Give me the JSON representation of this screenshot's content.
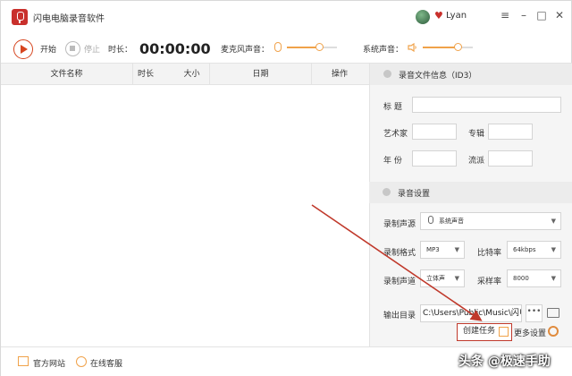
{
  "app": {
    "title": "闪电电脑录音软件",
    "user": "Lyan"
  },
  "window_controls": {
    "menu": "≡",
    "minimize": "–",
    "maximize": "□",
    "close": "✕"
  },
  "toolbar": {
    "start_label": "开始",
    "stop_label": "停止",
    "duration_label": "时长：",
    "duration_value": "00:00:00",
    "mic_volume_label": "麦克风声音：",
    "system_volume_label": "系统声音：",
    "mic_volume_level": 0.65,
    "system_volume_level": 0.7
  },
  "file_table": {
    "columns": [
      "文件名称",
      "时长",
      "大小",
      "日期",
      "操作"
    ],
    "rows": []
  },
  "id3_section": {
    "title": "录音文件信息（ID3）",
    "fields": {
      "title": "标  题",
      "artist": "艺术家",
      "album": "专辑",
      "year": "年  份",
      "genre": "流派"
    }
  },
  "record_settings": {
    "title": "录音设置",
    "source_label": "录制声源",
    "source_value": "系统声音",
    "format_label": "录制格式",
    "format_value": "MP3",
    "bitrate_label": "比特率",
    "bitrate_value": "64kbps",
    "channel_label": "录制声道",
    "channel_value": "立体声",
    "samplerate_label": "采样率",
    "samplerate_value": "8000",
    "output_label": "输出目录",
    "output_path": "C:\\Users\\Public\\Music\\闪电",
    "browse_label": "•••",
    "create_task_label": "创建任务",
    "more_settings_label": "更多设置"
  },
  "bottom": {
    "website_label": "官方网站",
    "help_label": "在线客服"
  },
  "watermark": "头条 @极速手助",
  "colors": {
    "accent": "#f0a24a",
    "brand": "#c9302c",
    "annotation": "#c0392b"
  }
}
